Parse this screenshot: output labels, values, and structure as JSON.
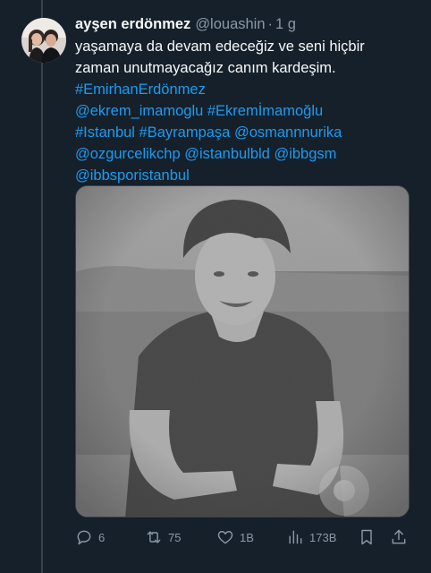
{
  "tweet": {
    "display_name": "ayşen erdönmez",
    "handle": "@louashin",
    "separator": "·",
    "time": "1 g",
    "text_lines": [
      "yaşamaya da devam edeceğiz ve seni hiçbir",
      "zaman unutmayacağız canım kardeşim."
    ],
    "link_lines": [
      "#EmirhanErdönmez",
      "@ekrem_imamoglu #Ekremİmamoğlu",
      "#Istanbul  #Bayrampaşa @osmannnurika",
      "@ozgurcelikchp @istanbulbld @ibbgsm",
      "@ibbsporistanbul"
    ]
  },
  "actions": {
    "reply": {
      "icon": "reply-icon",
      "count": "6"
    },
    "retweet": {
      "icon": "retweet-icon",
      "count": "75"
    },
    "like": {
      "icon": "heart-icon",
      "count": "1B"
    },
    "views": {
      "icon": "views-icon",
      "count": "173B"
    },
    "bookmark": {
      "icon": "bookmark-icon"
    },
    "share": {
      "icon": "share-icon"
    }
  },
  "colors": {
    "background": "#15202b",
    "text": "#f7f9f9",
    "secondary": "#8b98a5",
    "link": "#1d9bf0",
    "border": "#38444d"
  }
}
